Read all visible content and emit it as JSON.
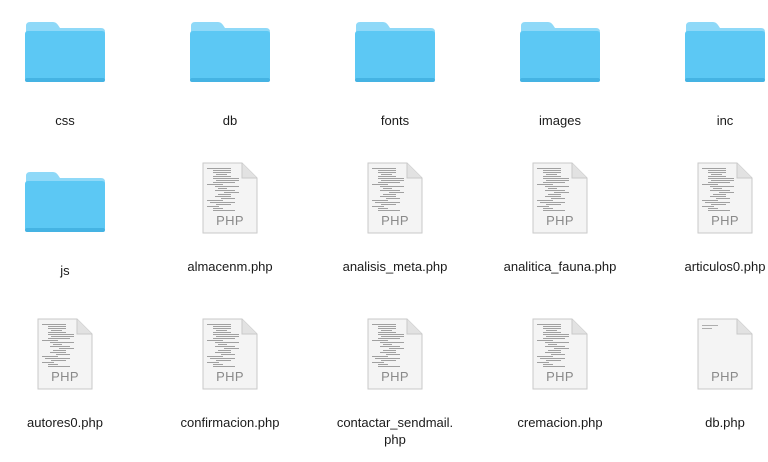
{
  "items": [
    {
      "name": "css",
      "kind": "folder"
    },
    {
      "name": "db",
      "kind": "folder"
    },
    {
      "name": "fonts",
      "kind": "folder"
    },
    {
      "name": "images",
      "kind": "folder"
    },
    {
      "name": "inc",
      "kind": "folder"
    },
    {
      "name": "js",
      "kind": "folder"
    },
    {
      "name": "almacenm.php",
      "kind": "php"
    },
    {
      "name": "analisis_meta.php",
      "kind": "php"
    },
    {
      "name": "analitica_fauna.php",
      "kind": "php"
    },
    {
      "name": "articulos0.php",
      "kind": "php"
    },
    {
      "name": "autores0.php",
      "kind": "php"
    },
    {
      "name": "confirmacion.php",
      "kind": "php"
    },
    {
      "name": "contactar_sendmail.\nphp",
      "kind": "php"
    },
    {
      "name": "cremacion.php",
      "kind": "php"
    },
    {
      "name": "db.php",
      "kind": "php-blank"
    }
  ],
  "php_badge": "PHP",
  "colors": {
    "folder_front": "#5cc8f4",
    "folder_back": "#8fd9f8",
    "doc_page": "#f4f4f4"
  }
}
